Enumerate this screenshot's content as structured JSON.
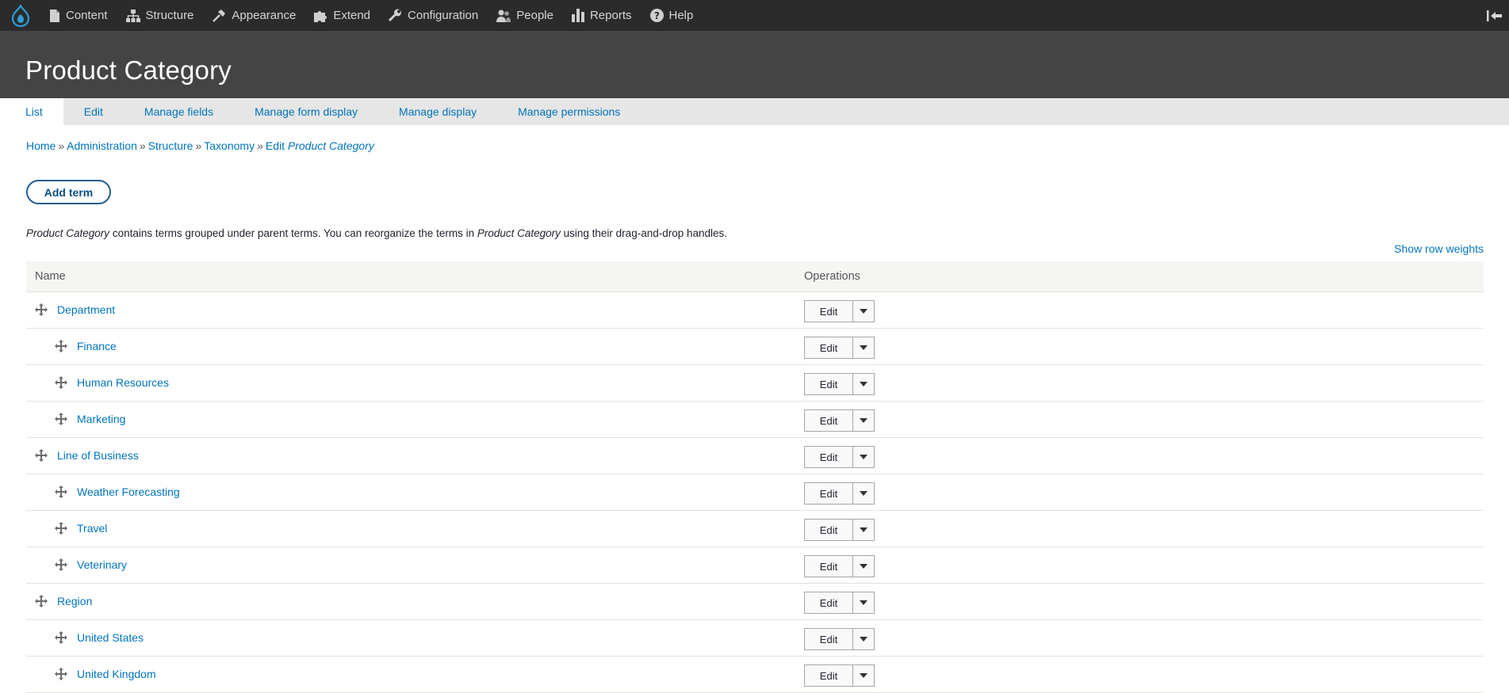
{
  "toolbar": {
    "items": [
      {
        "label": "Content",
        "icon": "document-icon"
      },
      {
        "label": "Structure",
        "icon": "sitemap-icon"
      },
      {
        "label": "Appearance",
        "icon": "brush-icon"
      },
      {
        "label": "Extend",
        "icon": "puzzle-icon"
      },
      {
        "label": "Configuration",
        "icon": "wrench-icon"
      },
      {
        "label": "People",
        "icon": "people-icon"
      },
      {
        "label": "Reports",
        "icon": "bar-chart-icon"
      },
      {
        "label": "Help",
        "icon": "help-icon"
      }
    ]
  },
  "header": {
    "title": "Product Category"
  },
  "tabs": [
    {
      "label": "List",
      "active": true
    },
    {
      "label": "Edit"
    },
    {
      "label": "Manage fields"
    },
    {
      "label": "Manage form display"
    },
    {
      "label": "Manage display"
    },
    {
      "label": "Manage permissions"
    }
  ],
  "breadcrumb": {
    "items": [
      "Home",
      "Administration",
      "Structure",
      "Taxonomy"
    ],
    "separator": "»",
    "last_prefix": "Edit",
    "last_em": "Product Category"
  },
  "actions": {
    "add_term": "Add term"
  },
  "description": {
    "em1": "Product Category",
    "text1": " contains terms grouped under parent terms. You can reorganize the terms in ",
    "em2": "Product Category",
    "text2": " using their drag-and-drop handles."
  },
  "show_row_weights": "Show row weights",
  "table": {
    "headers": {
      "name": "Name",
      "operations": "Operations"
    },
    "edit_label": "Edit",
    "rows": [
      {
        "name": "Department",
        "depth": 0
      },
      {
        "name": "Finance",
        "depth": 1
      },
      {
        "name": "Human Resources",
        "depth": 1
      },
      {
        "name": "Marketing",
        "depth": 1
      },
      {
        "name": "Line of Business",
        "depth": 0
      },
      {
        "name": "Weather Forecasting",
        "depth": 1
      },
      {
        "name": "Travel",
        "depth": 1
      },
      {
        "name": "Veterinary",
        "depth": 1
      },
      {
        "name": "Region",
        "depth": 0
      },
      {
        "name": "United States",
        "depth": 1
      },
      {
        "name": "United Kingdom",
        "depth": 1
      }
    ]
  },
  "colors": {
    "link": "#0074bd",
    "toolbar_bg": "#2b2b2b",
    "header_bg": "#444444",
    "logo": "#0d7ac0"
  }
}
